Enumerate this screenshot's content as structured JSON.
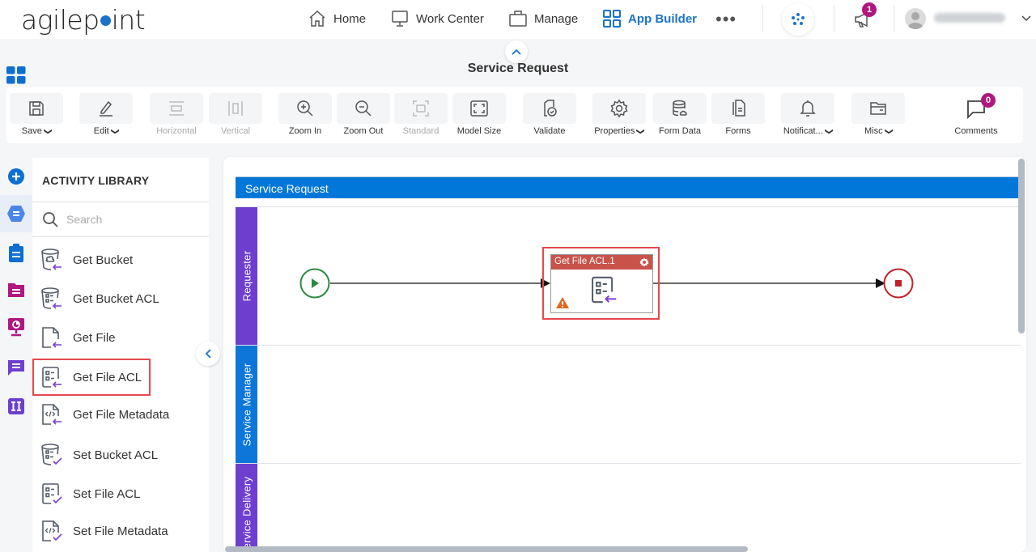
{
  "app": {
    "logo_text_left": "agilep",
    "logo_text_right": "int",
    "nav": [
      {
        "label": "Home",
        "icon": "home-icon",
        "active": false
      },
      {
        "label": "Work Center",
        "icon": "monitor-icon",
        "active": false
      },
      {
        "label": "Manage",
        "icon": "briefcase-icon",
        "active": false
      },
      {
        "label": "App Builder",
        "icon": "grid-icon",
        "active": true
      }
    ],
    "more_label": "•••",
    "notifications_count": "1",
    "user_name": "(blurred)",
    "accent_color": "#1a73c8"
  },
  "page": {
    "title": "Service Request"
  },
  "toolbar": {
    "items": [
      {
        "label": "Save",
        "icon": "save-icon",
        "dropdown": true,
        "disabled": false
      },
      {
        "label": "Edit",
        "icon": "pencil-icon",
        "dropdown": true,
        "disabled": false
      },
      {
        "label": "Horizontal",
        "icon": "horizontal-layout-icon",
        "dropdown": false,
        "disabled": true
      },
      {
        "label": "Vertical",
        "icon": "vertical-layout-icon",
        "dropdown": false,
        "disabled": true
      },
      {
        "label": "Zoom In",
        "icon": "zoom-in-icon",
        "dropdown": false,
        "disabled": false
      },
      {
        "label": "Zoom Out",
        "icon": "zoom-out-icon",
        "dropdown": false,
        "disabled": false
      },
      {
        "label": "Standard",
        "icon": "standard-size-icon",
        "dropdown": false,
        "disabled": true
      },
      {
        "label": "Model Size",
        "icon": "model-size-icon",
        "dropdown": false,
        "disabled": false
      },
      {
        "label": "Validate",
        "icon": "validate-icon",
        "dropdown": false,
        "disabled": false
      },
      {
        "label": "Properties",
        "icon": "gear-icon",
        "dropdown": true,
        "disabled": false
      },
      {
        "label": "Form Data",
        "icon": "database-icon",
        "dropdown": false,
        "disabled": false
      },
      {
        "label": "Forms",
        "icon": "forms-icon",
        "dropdown": false,
        "disabled": false
      },
      {
        "label": "Notificat...",
        "icon": "bell-icon",
        "dropdown": true,
        "disabled": false
      },
      {
        "label": "Misc",
        "icon": "folder-icon",
        "dropdown": true,
        "disabled": false
      }
    ],
    "comments": {
      "label": "Comments",
      "count": "0"
    }
  },
  "library": {
    "title": "ACTIVITY LIBRARY",
    "search_placeholder": "Search",
    "items": [
      {
        "label": "Get Bucket",
        "icon": "get-bucket-icon"
      },
      {
        "label": "Get Bucket ACL",
        "icon": "get-bucket-acl-icon"
      },
      {
        "label": "Get File",
        "icon": "get-file-icon"
      },
      {
        "label": "Get File ACL",
        "icon": "get-file-acl-icon",
        "selected": true
      },
      {
        "label": "Get File Metadata",
        "icon": "get-file-metadata-icon"
      },
      {
        "label": "Set Bucket ACL",
        "icon": "set-bucket-acl-icon"
      },
      {
        "label": "Set File ACL",
        "icon": "set-file-acl-icon"
      },
      {
        "label": "Set File Metadata",
        "icon": "set-file-metadata-icon"
      }
    ]
  },
  "side_rail": [
    {
      "icon": "add-icon",
      "color": "#0d6fd1"
    },
    {
      "icon": "hexagon-activity-icon",
      "color": "#4a86e8",
      "active": true
    },
    {
      "icon": "clipboard-icon",
      "color": "#0d6fd1"
    },
    {
      "icon": "folder-form-icon",
      "color": "#b0177f"
    },
    {
      "icon": "monitor-chart-icon",
      "color": "#b0177f"
    },
    {
      "icon": "chat-icon",
      "color": "#6c3fd1"
    },
    {
      "icon": "integration-icon",
      "color": "#6c3fd1"
    }
  ],
  "process": {
    "pool_name": "Service Request",
    "lanes": [
      {
        "name": "Requester",
        "color": "#6e3fcf"
      },
      {
        "name": "Service Manager",
        "color": "#0d77d9"
      },
      {
        "name": "Service Delivery",
        "color": "#6e3fcf"
      }
    ],
    "task": {
      "title": "Get File ACL.1",
      "header_color": "#c9534a",
      "has_warning": true
    },
    "start_color": "#2a8a3e",
    "end_color": "#c2202a"
  }
}
